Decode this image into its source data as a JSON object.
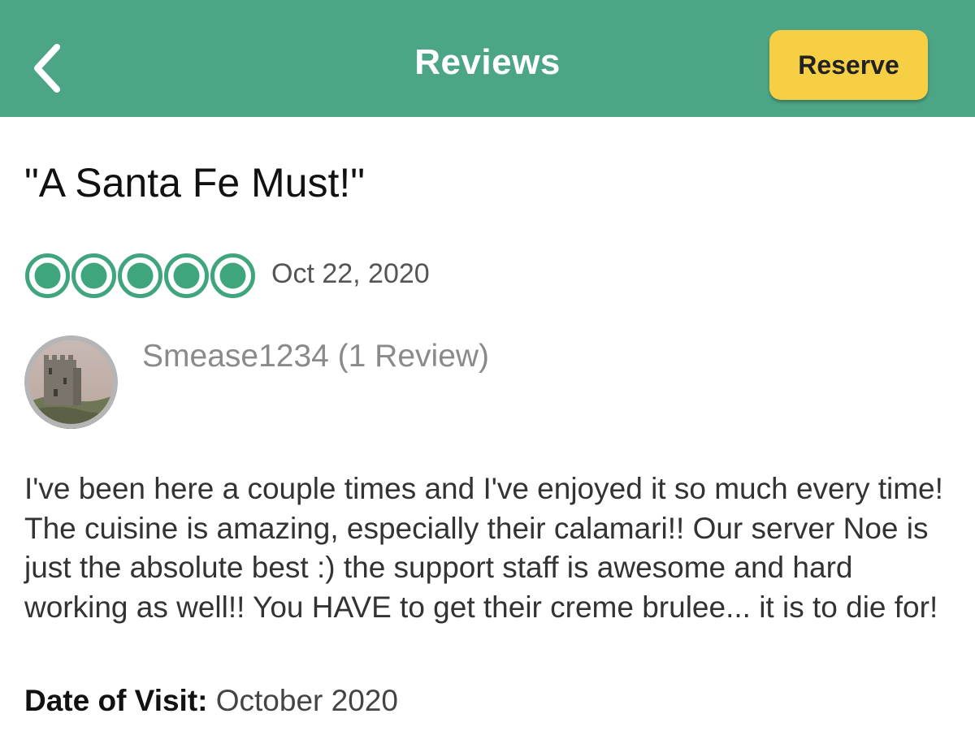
{
  "header": {
    "title": "Reviews",
    "reserve_label": "Reserve",
    "back_icon": "chevron-left-icon",
    "bg_color": "#4ca585",
    "reserve_color": "#f6cf45"
  },
  "review": {
    "title": "\"A Santa Fe Must!\"",
    "rating": 5,
    "rating_max": 5,
    "rating_color": "#3fa57c",
    "date": "Oct 22, 2020",
    "author": "Smease1234 (1 Review)",
    "body": "I've been here a couple times and I've enjoyed it so much every time! The cuisine is amazing, especially their calamari!! Our server Noe is just the absolute best :) the support staff is awesome and hard working as well!! You HAVE to get their creme brulee... it is to die for!",
    "visit_label": "Date of Visit:",
    "visit_value": "October 2020"
  }
}
